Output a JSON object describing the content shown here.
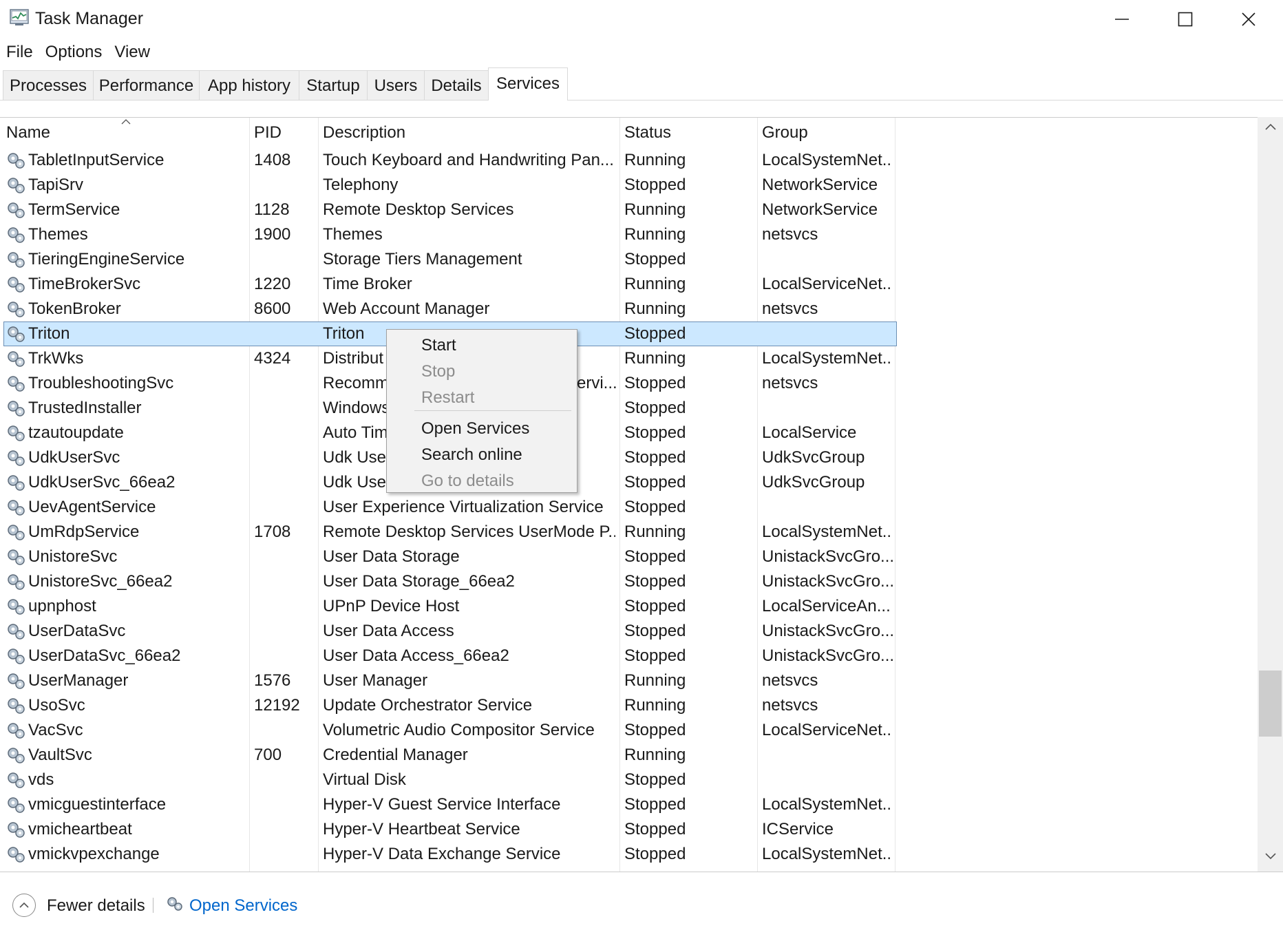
{
  "window": {
    "title": "Task Manager"
  },
  "menu": [
    "File",
    "Options",
    "View"
  ],
  "tabs": [
    "Processes",
    "Performance",
    "App history",
    "Startup",
    "Users",
    "Details",
    "Services"
  ],
  "active_tab": "Services",
  "columns": {
    "name": "Name",
    "pid": "PID",
    "description": "Description",
    "status": "Status",
    "group": "Group"
  },
  "rows": [
    {
      "name": "TabletInputService",
      "pid": "1408",
      "description": "Touch Keyboard and Handwriting Pan...",
      "status": "Running",
      "group": "LocalSystemNet..."
    },
    {
      "name": "TapiSrv",
      "pid": "",
      "description": "Telephony",
      "status": "Stopped",
      "group": "NetworkService"
    },
    {
      "name": "TermService",
      "pid": "1128",
      "description": "Remote Desktop Services",
      "status": "Running",
      "group": "NetworkService"
    },
    {
      "name": "Themes",
      "pid": "1900",
      "description": "Themes",
      "status": "Running",
      "group": "netsvcs"
    },
    {
      "name": "TieringEngineService",
      "pid": "",
      "description": "Storage Tiers Management",
      "status": "Stopped",
      "group": ""
    },
    {
      "name": "TimeBrokerSvc",
      "pid": "1220",
      "description": "Time Broker",
      "status": "Running",
      "group": "LocalServiceNet..."
    },
    {
      "name": "TokenBroker",
      "pid": "8600",
      "description": "Web Account Manager",
      "status": "Running",
      "group": "netsvcs"
    },
    {
      "name": "Triton",
      "pid": "",
      "description": "Triton",
      "status": "Stopped",
      "group": "",
      "selected": true
    },
    {
      "name": "TrkWks",
      "pid": "4324",
      "description": "Distribut",
      "status": "Running",
      "group": "LocalSystemNet..."
    },
    {
      "name": "TroubleshootingSvc",
      "pid": "",
      "description": "Recomm",
      "status": "Stopped",
      "group": "netsvcs"
    },
    {
      "name": "TrustedInstaller",
      "pid": "",
      "description": "Windows",
      "status": "Stopped",
      "group": ""
    },
    {
      "name": "tzautoupdate",
      "pid": "",
      "description": "Auto Tim",
      "status": "Stopped",
      "group": "LocalService"
    },
    {
      "name": "UdkUserSvc",
      "pid": "",
      "description": "Udk User",
      "status": "Stopped",
      "group": "UdkSvcGroup"
    },
    {
      "name": "UdkUserSvc_66ea2",
      "pid": "",
      "description": "Udk User",
      "status": "Stopped",
      "group": "UdkSvcGroup"
    },
    {
      "name": "UevAgentService",
      "pid": "",
      "description": "User Experience Virtualization Service",
      "status": "Stopped",
      "group": ""
    },
    {
      "name": "UmRdpService",
      "pid": "1708",
      "description": "Remote Desktop Services UserMode P...",
      "status": "Running",
      "group": "LocalSystemNet..."
    },
    {
      "name": "UnistoreSvc",
      "pid": "",
      "description": "User Data Storage",
      "status": "Stopped",
      "group": "UnistackSvcGro..."
    },
    {
      "name": "UnistoreSvc_66ea2",
      "pid": "",
      "description": "User Data Storage_66ea2",
      "status": "Stopped",
      "group": "UnistackSvcGro..."
    },
    {
      "name": "upnphost",
      "pid": "",
      "description": "UPnP Device Host",
      "status": "Stopped",
      "group": "LocalServiceAn..."
    },
    {
      "name": "UserDataSvc",
      "pid": "",
      "description": "User Data Access",
      "status": "Stopped",
      "group": "UnistackSvcGro..."
    },
    {
      "name": "UserDataSvc_66ea2",
      "pid": "",
      "description": "User Data Access_66ea2",
      "status": "Stopped",
      "group": "UnistackSvcGro..."
    },
    {
      "name": "UserManager",
      "pid": "1576",
      "description": "User Manager",
      "status": "Running",
      "group": "netsvcs"
    },
    {
      "name": "UsoSvc",
      "pid": "12192",
      "description": "Update Orchestrator Service",
      "status": "Running",
      "group": "netsvcs"
    },
    {
      "name": "VacSvc",
      "pid": "",
      "description": "Volumetric Audio Compositor Service",
      "status": "Stopped",
      "group": "LocalServiceNet..."
    },
    {
      "name": "VaultSvc",
      "pid": "700",
      "description": "Credential Manager",
      "status": "Running",
      "group": ""
    },
    {
      "name": "vds",
      "pid": "",
      "description": "Virtual Disk",
      "status": "Stopped",
      "group": ""
    },
    {
      "name": "vmicguestinterface",
      "pid": "",
      "description": "Hyper-V Guest Service Interface",
      "status": "Stopped",
      "group": "LocalSystemNet..."
    },
    {
      "name": "vmicheartbeat",
      "pid": "",
      "description": "Hyper-V Heartbeat Service",
      "status": "Stopped",
      "group": "ICService"
    },
    {
      "name": "vmickvpexchange",
      "pid": "",
      "description": "Hyper-V Data Exchange Service",
      "status": "Stopped",
      "group": "LocalSystemNet..."
    },
    {
      "name": "",
      "pid": "",
      "description": "",
      "status": "",
      "group": ""
    }
  ],
  "context_menu": {
    "items": [
      {
        "label": "Start",
        "enabled": true
      },
      {
        "label": "Stop",
        "enabled": false
      },
      {
        "label": "Restart",
        "enabled": false
      },
      {
        "label": "Open Services",
        "enabled": true
      },
      {
        "label": "Search online",
        "enabled": true
      },
      {
        "label": "Go to details",
        "enabled": false
      }
    ],
    "fragment_trkwks": "ervi..."
  },
  "bottom": {
    "fewer_details": "Fewer details",
    "open_services": "Open Services"
  },
  "colors": {
    "selection": "#cce8ff",
    "link": "#0066cc",
    "disabled": "#8c8c8c"
  }
}
